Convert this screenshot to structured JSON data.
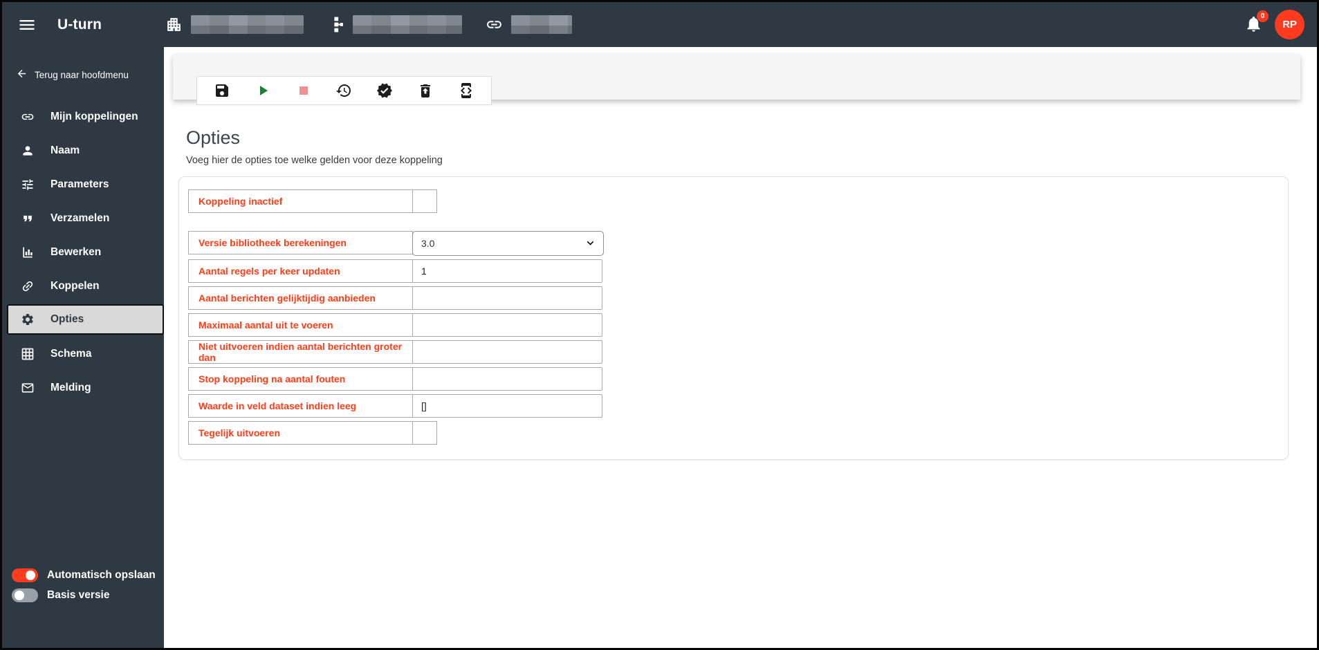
{
  "navbar": {
    "title": "U-turn",
    "hamburger_icon": "menu-icon",
    "bell_icon": "bell-icon",
    "bell_badge": "0",
    "avatar_initials": "RP",
    "redacted_segments": [
      {
        "icon": "building-icon",
        "blur_width": 163
      },
      {
        "icon": "hierarchy-icon",
        "blur_width": 158
      },
      {
        "icon": "link-icon",
        "blur_width": 88
      }
    ]
  },
  "sidebar": {
    "back_label": "Terug naar hoofdmenu",
    "back_icon": "arrow-left-icon",
    "items": [
      {
        "label": "Mijn koppelingen",
        "icon": "link-icon",
        "selected": false
      },
      {
        "label": "Naam",
        "icon": "person-icon",
        "selected": false
      },
      {
        "label": "Parameters",
        "icon": "tune-icon",
        "selected": false
      },
      {
        "label": "Verzamelen",
        "icon": "quote-icon",
        "selected": false
      },
      {
        "label": "Bewerken",
        "icon": "bar-chart-icon",
        "selected": false
      },
      {
        "label": "Koppelen",
        "icon": "chain-icon",
        "selected": false
      },
      {
        "label": "Opties",
        "icon": "gear-icon",
        "selected": true
      },
      {
        "label": "Schema",
        "icon": "grid-icon",
        "selected": false
      },
      {
        "label": "Melding",
        "icon": "envelope-icon",
        "selected": false
      }
    ],
    "toggles": [
      {
        "label": "Automatisch opslaan",
        "on": true
      },
      {
        "label": "Basis versie",
        "on": false
      }
    ]
  },
  "toolbar": {
    "buttons": [
      {
        "name": "save-button",
        "icon": "save-icon",
        "color": "#1d1d1d"
      },
      {
        "name": "run-button",
        "icon": "play-icon",
        "color": "#1e7e34"
      },
      {
        "name": "stop-button",
        "icon": "stop-icon",
        "color": "#ee9191"
      },
      {
        "name": "history-button",
        "icon": "history-icon",
        "color": "#1d1d1d"
      },
      {
        "name": "validate-button",
        "icon": "verified-icon",
        "color": "#1d1d1d"
      },
      {
        "name": "restore-trash-button",
        "icon": "restore-trash-icon",
        "color": "#1d1d1d"
      },
      {
        "name": "developer-mode-button",
        "icon": "developer-mode-icon",
        "color": "#1d1d1d"
      }
    ]
  },
  "page": {
    "title": "Opties",
    "subtitle": "Voeg hier de opties toe welke gelden voor deze koppeling"
  },
  "form": {
    "rows": [
      {
        "label": "Koppeling inactief",
        "type": "checkbox",
        "value": false,
        "gap_after": true
      },
      {
        "label": "Versie bibliotheek berekeningen",
        "type": "select",
        "value": "3.0",
        "options": [
          "3.0"
        ],
        "gap_after": false
      },
      {
        "label": "Aantal regels per keer updaten",
        "type": "input",
        "value": "1",
        "gap_after": false
      },
      {
        "label": "Aantal berichten gelijktijdig aanbieden",
        "type": "input",
        "value": "",
        "gap_after": false
      },
      {
        "label": "Maximaal aantal uit te voeren",
        "type": "input",
        "value": "",
        "gap_after": false
      },
      {
        "label": "Niet uitvoeren indien aantal berichten groter dan",
        "type": "input",
        "value": "",
        "gap_after": false
      },
      {
        "label": "Stop koppeling na aantal fouten",
        "type": "input",
        "value": "",
        "gap_after": false
      },
      {
        "label": "Waarde in veld dataset indien leeg",
        "type": "input",
        "value": "[]",
        "gap_after": false
      },
      {
        "label": "Tegelijk uitvoeren",
        "type": "checkbox",
        "value": false,
        "gap_after": false
      }
    ]
  },
  "colors": {
    "navbar_bg": "#2e3944",
    "accent_red": "#fe3b1f",
    "label_red": "#ff3d17",
    "selected_item_bg": "#d9d9d9",
    "band_bg": "#f5f5f5",
    "play_green": "#1e7e34",
    "stop_pink": "#ee9191"
  }
}
